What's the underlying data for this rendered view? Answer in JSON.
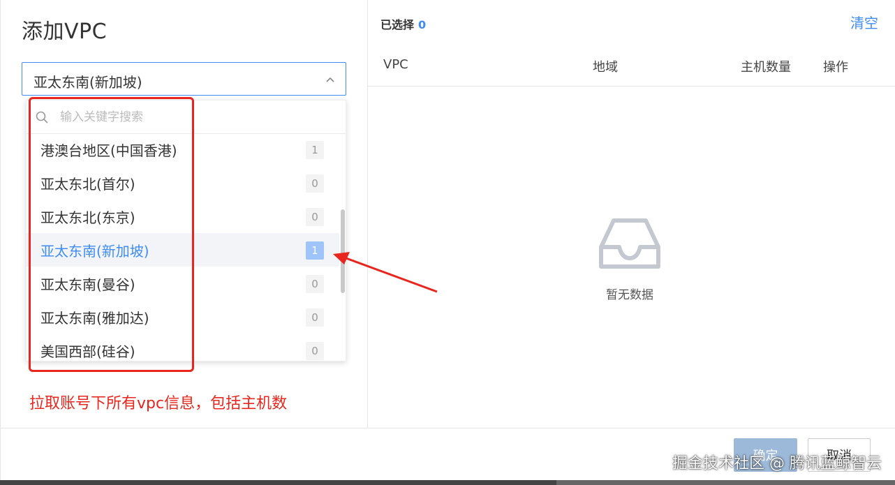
{
  "dialog": {
    "title": "添加VPC"
  },
  "region_select": {
    "value": "亚太东南(新加坡)"
  },
  "search": {
    "placeholder": "输入关键字搜索"
  },
  "regions": [
    {
      "label": "港澳台地区(中国香港)",
      "count": "1"
    },
    {
      "label": "亚太东北(首尔)",
      "count": "0"
    },
    {
      "label": "亚太东北(东京)",
      "count": "0"
    },
    {
      "label": "亚太东南(新加坡)",
      "count": "1",
      "active": true
    },
    {
      "label": "亚太东南(曼谷)",
      "count": "0"
    },
    {
      "label": "亚太东南(雅加达)",
      "count": "0"
    },
    {
      "label": "美国西部(硅谷)",
      "count": "0"
    }
  ],
  "annotation": {
    "text": "拉取账号下所有vpc信息，包括主机数"
  },
  "selected": {
    "label": "已选择",
    "count": "0",
    "clear": "清空"
  },
  "table": {
    "columns": [
      "VPC",
      "地域",
      "主机数量",
      "操作"
    ]
  },
  "empty": {
    "text": "暂无数据",
    "icon": "inbox-icon"
  },
  "footer": {
    "confirm": "确定",
    "cancel": "取消"
  },
  "watermark": {
    "text": "掘金技术社区 @ 腾讯蓝鲸智云"
  },
  "colors": {
    "accent": "#3f8cf7",
    "annotation": "#e8261d",
    "badge_active": "#9ec4fa"
  }
}
